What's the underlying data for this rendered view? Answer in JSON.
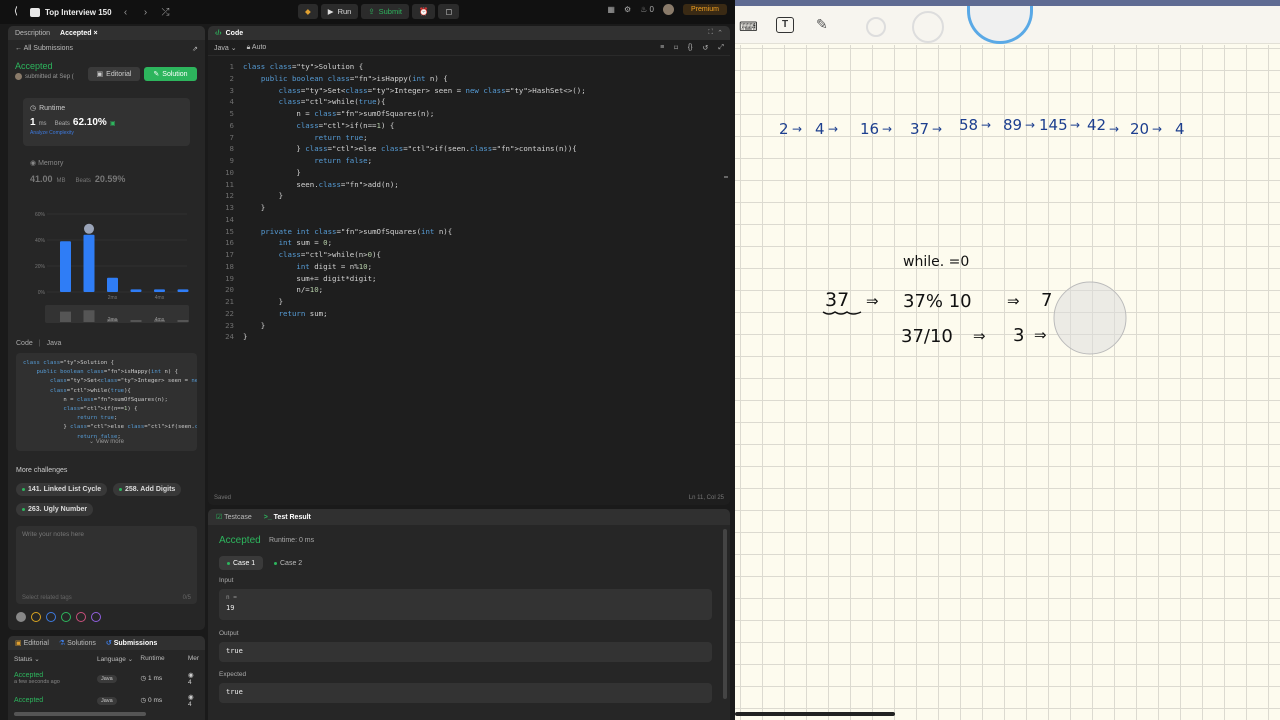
{
  "topbar": {
    "problem_list": "Top Interview 150",
    "run_label": "Run",
    "submit_label": "Submit",
    "streak": "0",
    "premium_label": "Premium"
  },
  "left_tabs": {
    "description": "Description",
    "accepted": "Accepted"
  },
  "submission": {
    "all_submissions": "All Submissions",
    "status": "Accepted",
    "submitted_at": "submitted at Sep (",
    "editorial_btn": "Editorial",
    "solution_btn": "Solution",
    "runtime_label": "Runtime",
    "runtime_value": "1",
    "runtime_unit": "ms",
    "beats_label": "Beats",
    "runtime_beats": "62.10%",
    "analyze": "Analyze Complexity",
    "memory_label": "Memory",
    "memory_value": "41.00",
    "memory_unit": "MB",
    "memory_beats": "20.59%",
    "code_label": "Code",
    "code_lang": "Java",
    "view_more": "View more"
  },
  "chart_data": {
    "type": "bar",
    "categories": [
      "",
      "",
      "2ms",
      "",
      "4ms",
      ""
    ],
    "values": [
      39,
      44,
      11,
      2,
      2,
      2
    ],
    "highlight_index": 1,
    "ylim": [
      0,
      60
    ],
    "yticks": [
      "60%",
      "40%",
      "20%",
      "0%"
    ],
    "bar_color": "#2f7df6",
    "mini_labels": [
      "2ms",
      "4ms"
    ]
  },
  "code_preview": [
    "class Solution {",
    "    public boolean isHappy(int n) {",
    "        Set<Integer> seen = new HashSet<>()",
    "        while(true){",
    "            n = sumOfSquares(n);",
    "            if(n==1) {",
    "                return true;",
    "            } else if(seen.contains(n)){",
    "                return false;"
  ],
  "more_challenges": {
    "title": "More challenges",
    "items": [
      "141. Linked List Cycle",
      "258. Add Digits",
      "263. Ugly Number"
    ]
  },
  "notes": {
    "placeholder": "Write your notes here",
    "tags": "Select related tags",
    "count": "0/5"
  },
  "swatch_colors": [
    "#888888",
    "#d9a520",
    "#3d7adf",
    "#2db55d",
    "#c94f7c",
    "#8f5fe0"
  ],
  "subs_panel": {
    "tabs": [
      "Editorial",
      "Solutions",
      "Submissions"
    ],
    "headers": [
      "Status",
      "Language",
      "Runtime",
      "Mer"
    ],
    "rows": [
      {
        "status": "Accepted",
        "time": "a few seconds ago",
        "lang": "Java",
        "runtime": "1 ms",
        "mem": "4"
      },
      {
        "status": "Accepted",
        "time": "",
        "lang": "Java",
        "runtime": "0 ms",
        "mem": "4"
      }
    ]
  },
  "editor": {
    "title": "Code",
    "lang": "Java",
    "mode": "Auto",
    "saved": "Saved",
    "cursor": "Ln 11, Col 25",
    "lines": [
      "class Solution {",
      "    public boolean isHappy(int n) {",
      "        Set<Integer> seen = new HashSet<>();",
      "        while(true){",
      "            n = sumOfSquares(n);",
      "            if(n==1) {",
      "                return true;",
      "            } else if(seen.contains(n)){",
      "                return false;",
      "            }",
      "            seen.add(n);",
      "        }",
      "    }",
      "",
      "    private int sumOfSquares(int n){",
      "        int sum = 0;",
      "        while(n>0){",
      "            int digit = n%10;",
      "            sum+= digit*digit;",
      "            n/=10;",
      "        }",
      "        return sum;",
      "    }",
      "}"
    ]
  },
  "test": {
    "tab_testcase": "Testcase",
    "tab_result": "Test Result",
    "status": "Accepted",
    "runtime": "Runtime: 0 ms",
    "case1": "Case 1",
    "case2": "Case 2",
    "input_label": "Input",
    "input_var": "n =",
    "input_value": "19",
    "output_label": "Output",
    "output_value": "true",
    "expected_label": "Expected",
    "expected_value": "true"
  },
  "whiteboard": {
    "sequence": [
      "2",
      "4",
      "16",
      "37",
      "58",
      "89",
      "145",
      "42",
      "20",
      "4"
    ],
    "note_while": "while. =0",
    "step1_left": "37",
    "step1_right": "37% 10",
    "step1_result": "7",
    "step2_left": "37/10",
    "step2_result": "3",
    "ink_color": "#1d3f8f"
  }
}
